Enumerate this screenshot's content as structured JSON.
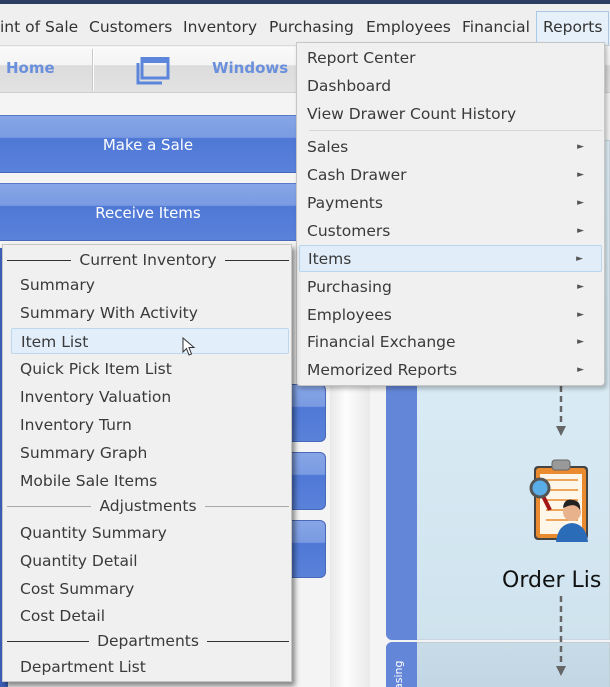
{
  "menubar": {
    "items": [
      {
        "label": "int of Sale"
      },
      {
        "label": "Customers"
      },
      {
        "label": "Inventory"
      },
      {
        "label": "Purchasing"
      },
      {
        "label": "Employees"
      },
      {
        "label": "Financial"
      },
      {
        "label": "Reports",
        "active": true
      }
    ]
  },
  "toolbar": {
    "home_label": "Home",
    "windows_label": "Windows",
    "windows_icon": "windows-icon"
  },
  "left_panel": {
    "make_sale_label": "Make a Sale",
    "receive_items_label": "Receive Items"
  },
  "workflow": {
    "order_list_label": "Order Lis",
    "section_label": "asing",
    "order_icon": "clipboard-person-icon"
  },
  "reports_menu": {
    "items": [
      {
        "label": "Report Center",
        "submenu": false
      },
      {
        "label": "Dashboard",
        "submenu": false
      },
      {
        "label": "View Drawer Count History",
        "submenu": false
      },
      {
        "label": "Sales",
        "submenu": true
      },
      {
        "label": "Cash Drawer",
        "submenu": true
      },
      {
        "label": "Payments",
        "submenu": true
      },
      {
        "label": "Customers",
        "submenu": true
      },
      {
        "label": "Items",
        "submenu": true,
        "highlighted": true
      },
      {
        "label": "Purchasing",
        "submenu": true
      },
      {
        "label": "Employees",
        "submenu": true
      },
      {
        "label": "Financial Exchange",
        "submenu": true
      },
      {
        "label": "Memorized Reports",
        "submenu": true
      }
    ],
    "submenu_arrow": "►"
  },
  "items_menu": {
    "sections": [
      {
        "header": "Current Inventory",
        "items": [
          "Summary",
          "Summary With Activity",
          "Item List",
          "Quick Pick Item List",
          "Inventory Valuation",
          "Inventory Turn",
          "Summary Graph",
          "Mobile Sale Items"
        ]
      },
      {
        "header": "Adjustments",
        "items": [
          "Quantity Summary",
          "Quantity Detail",
          "Cost Summary",
          "Cost Detail"
        ]
      },
      {
        "header": "Departments",
        "items": [
          "Department List"
        ]
      }
    ],
    "highlighted": "Item List"
  }
}
